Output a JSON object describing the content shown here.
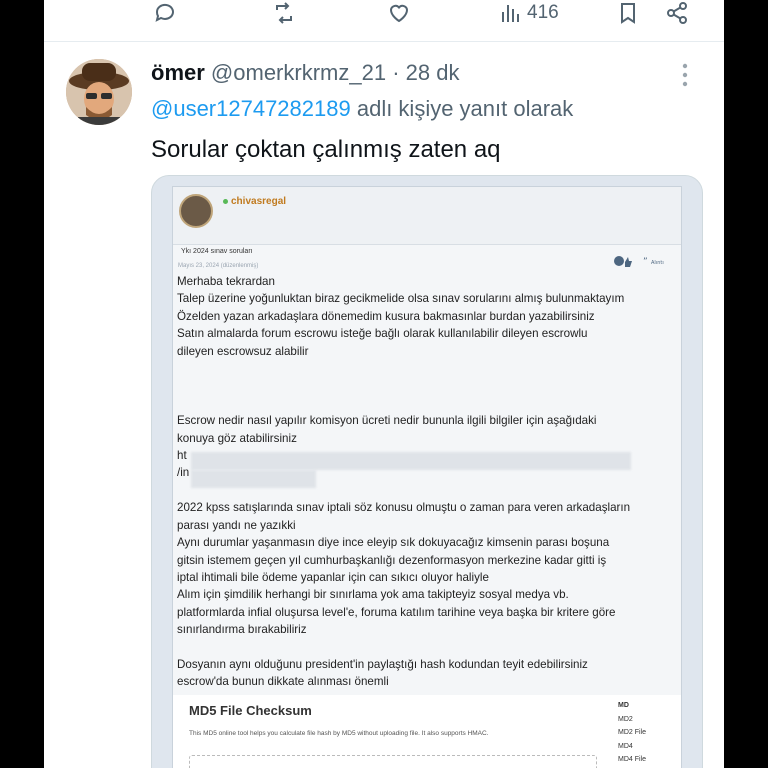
{
  "actions": {
    "reply_icon": "speech-bubble",
    "retweet_icon": "retweet-arrows",
    "like_icon": "heart",
    "views_icon": "bar-chart",
    "views_count": "416",
    "bookmark_icon": "bookmark",
    "share_icon": "share-nodes"
  },
  "tweet": {
    "author_name": "ömer",
    "author_handle": "@omerkrkrmz_21",
    "separator": "·",
    "time": "28 dk",
    "reply_mention": "@user12747282189",
    "reply_suffix": "adlı kişiye yanıt olarak",
    "text": "Sorular çoktan çalınmış zaten aq"
  },
  "forum": {
    "username": "chivasregal",
    "thread_title": "Ykı 2024 sınav soruları",
    "post_date": "Mayıs 23, 2024 (düzenlenmiş)",
    "alinti": "Alıntı",
    "lines": [
      "Merhaba tekrardan",
      "Talep üzerine yoğunluktan biraz gecikmelide olsa sınav sorularını almış bulunmaktayım",
      "Özelden yazan arkadaşlara dönemedim kusura bakmasınlar burdan yazabilirsiniz",
      "Satın almalarda forum escrowu isteğe bağlı olarak kullanılabilir dileyen escrowlu",
      "dileyen escrowsuz alabilir",
      "",
      "",
      "",
      "Escrow nedir nasıl yapılır komisyon ücreti nedir bununla ilgili bilgiler için aşağıdaki",
      "konuya göz atabilirsiniz",
      "ht",
      "/in",
      "",
      "2022 kpss satışlarında sınav iptali söz konusu olmuştu o zaman para veren arkadaşların",
      "parası yandı ne yazıkki",
      "Aynı durumlar yaşanmasın diye ince eleyip sık dokuyacağız kimsenin parası boşuna",
      "gitsin istemem geçen yıl cumhurbaşkanlığı dezenformasyon merkezine kadar gitti iş",
      "iptal ihtimali bile ödeme yapanlar için can sıkıcı oluyor haliyle",
      "Alım için şimdilik herhangi bir sınırlama yok ama takipteyiz sosyal medya vb.",
      "platformlarda infial oluşursa level'e, foruma katılım tarihine veya başka bir kritere göre",
      "sınırlandırma bırakabiliriz",
      "",
      "Dosyanın aynı olduğunu president'in paylaştığı hash kodundan teyit edebilirsiniz",
      "escrow'da bunun dikkate alınması önemli"
    ],
    "checksum": {
      "title": "MD5 File Checksum",
      "subtitle": "This MD5 online tool helps you calculate file hash by MD5 without uploading file. It also supports HMAC.",
      "side_items": [
        "MD",
        "MD2",
        "MD2 File",
        "MD4",
        "MD4 File"
      ]
    }
  }
}
